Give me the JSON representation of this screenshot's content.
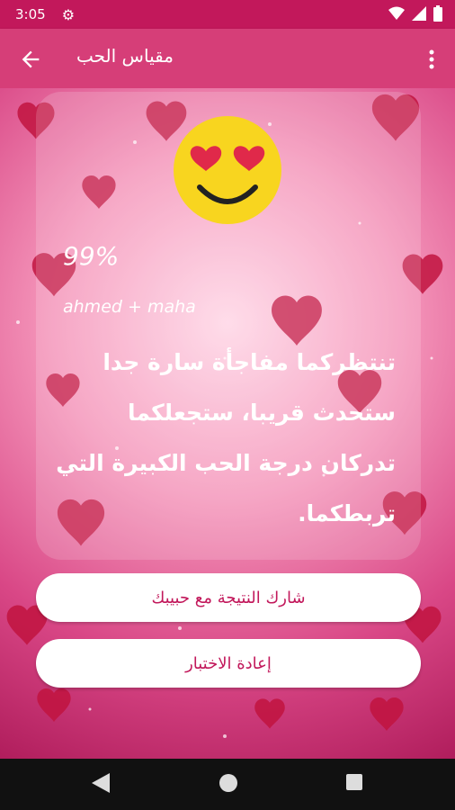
{
  "status_bar": {
    "time": "3:05",
    "icons": [
      "gear-icon",
      "wifi-icon",
      "signal-icon",
      "battery-icon"
    ]
  },
  "app_bar": {
    "title": "مقياس الحب",
    "back_icon": "arrow-back-icon",
    "menu_icon": "overflow-menu-icon"
  },
  "result": {
    "percent": "99%",
    "names": "ahmed + maha",
    "message": "تنتظركما مفاجأة سارة جدا ستحدث قريبا، ستجعلكما تدركان درجة الحب الكبيرة التي تربطكما."
  },
  "buttons": {
    "share": "شارك النتيجة مع حبيبك",
    "retry": "إعادة الاختبار"
  },
  "colors": {
    "primary": "#c2185b",
    "app_bar": "#d63e78",
    "button_text": "#c2185b"
  }
}
